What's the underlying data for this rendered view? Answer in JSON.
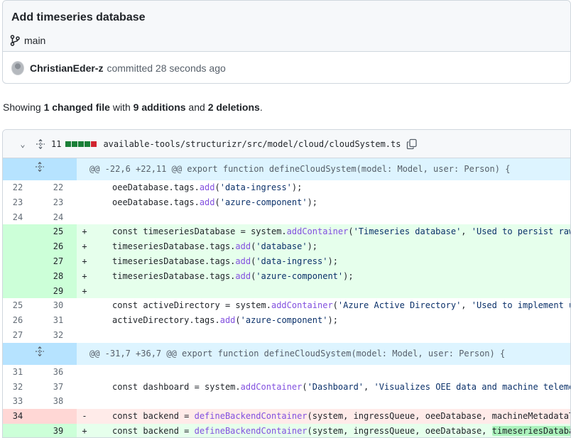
{
  "commit": {
    "title": "Add timeseries database",
    "branch": "main",
    "author": "ChristianEder-z",
    "action": "committed 28 seconds ago"
  },
  "summary": {
    "prefix": "Showing ",
    "files": "1 changed file",
    "mid": " with ",
    "additions": "9 additions",
    "and": " and ",
    "deletions": "2 deletions",
    "suffix": "."
  },
  "file": {
    "changes": "11",
    "path": "available-tools/structurizr/src/model/cloud/cloudSystem.ts",
    "icons": {
      "collapse": "chevron-down-icon",
      "move": "move-icon",
      "copy": "copy-icon",
      "expand": "unfold-icon"
    }
  },
  "diff": {
    "hunk1": "@@ -22,6 +22,11 @@ export function defineCloudSystem(model: Model, user: Person) {",
    "hunk2": "@@ -31,7 +36,7 @@ export function defineCloudSystem(model: Model, user: Person) {",
    "lines": [
      {
        "old": "22",
        "new": "22",
        "sign": "",
        "type": "ctx",
        "code": "oeeDatabase.tags.add('data-ingress');"
      },
      {
        "old": "23",
        "new": "23",
        "sign": "",
        "type": "ctx",
        "code": "oeeDatabase.tags.add('azure-component');"
      },
      {
        "old": "24",
        "new": "24",
        "sign": "",
        "type": "ctx",
        "code": ""
      },
      {
        "old": "",
        "new": "25",
        "sign": "+",
        "type": "add",
        "code": "const timeseriesDatabase = system.addContainer('Timeseries database', 'Used to persist raw mac"
      },
      {
        "old": "",
        "new": "26",
        "sign": "+",
        "type": "add",
        "code": "timeseriesDatabase.tags.add('database');"
      },
      {
        "old": "",
        "new": "27",
        "sign": "+",
        "type": "add",
        "code": "timeseriesDatabase.tags.add('data-ingress');"
      },
      {
        "old": "",
        "new": "28",
        "sign": "+",
        "type": "add",
        "code": "timeseriesDatabase.tags.add('azure-component');"
      },
      {
        "old": "",
        "new": "29",
        "sign": "+",
        "type": "add",
        "code": ""
      },
      {
        "old": "25",
        "new": "30",
        "sign": "",
        "type": "ctx",
        "code": "const activeDirectory = system.addContainer('Azure Active Directory', 'Used to implement user"
      },
      {
        "old": "26",
        "new": "31",
        "sign": "",
        "type": "ctx",
        "code": "activeDirectory.tags.add('azure-component');"
      },
      {
        "old": "27",
        "new": "32",
        "sign": "",
        "type": "ctx",
        "code": ""
      },
      {
        "old": "31",
        "new": "36",
        "sign": "",
        "type": "ctx",
        "code": ""
      },
      {
        "old": "32",
        "new": "37",
        "sign": "",
        "type": "ctx",
        "code": "const dashboard = system.addContainer('Dashboard', 'Visualizes OEE data and machine telemetry"
      },
      {
        "old": "33",
        "new": "38",
        "sign": "",
        "type": "ctx",
        "code": ""
      },
      {
        "old": "34",
        "new": "",
        "sign": "-",
        "type": "del",
        "code": "const backend = defineBackendContainer(system, ingressQueue, oeeDatabase, machineMetadataTrans"
      },
      {
        "old": "",
        "new": "39",
        "sign": "+",
        "type": "add",
        "code": "const backend = defineBackendContainer(system, ingressQueue, oeeDatabase, timeseriesDatabase,"
      }
    ]
  },
  "colors": {
    "diffstat": [
      "#1a7f37",
      "#1a7f37",
      "#1a7f37",
      "#1a7f37",
      "#d1242f"
    ]
  }
}
